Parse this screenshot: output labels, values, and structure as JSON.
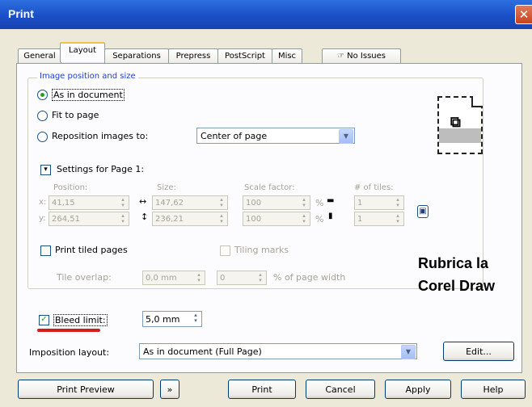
{
  "window": {
    "title": "Print",
    "close_glyph": "✕"
  },
  "tabs": [
    "General",
    "Layout",
    "Separations",
    "Prepress",
    "PostScript",
    "Misc",
    "No Issues"
  ],
  "image_position": {
    "group_label": "Image position and size",
    "options": [
      "As in document",
      "Fit to page",
      "Reposition images to:"
    ],
    "selected_index": 0,
    "reposition_value": "Center of page"
  },
  "settings": {
    "label": "Settings for Page 1:",
    "columns": {
      "position": "Position:",
      "size": "Size:",
      "scale": "Scale factor:",
      "tiles": "# of tiles:"
    },
    "x_label": "x:",
    "y_label": "y:",
    "position_x": "41,15",
    "position_y": "264,51",
    "size_w": "147,62",
    "size_h": "236,21",
    "scale_x": "100",
    "scale_y": "100",
    "percent": "%",
    "tiles_x": "1",
    "tiles_y": "1"
  },
  "tiling": {
    "print_tiled_label": "Print tiled pages",
    "tiling_marks_label": "Tiling marks",
    "overlap_label": "Tile overlap:",
    "overlap_value": "0,0 mm",
    "overlap_pct_value": "0",
    "pct_of_width_label": "% of page width"
  },
  "watermark": {
    "line1": "Rubrica la",
    "line2": "Corel Draw"
  },
  "bleed": {
    "label": "Bleed limit:",
    "checked": true,
    "value": "5,0 mm"
  },
  "imposition": {
    "label": "Imposition layout:",
    "value": "As in document (Full Page)",
    "edit_label": "Edit..."
  },
  "footer": {
    "print_preview": "Print Preview",
    "print": "Print",
    "cancel": "Cancel",
    "apply": "Apply",
    "help": "Help"
  },
  "icons": {
    "close": "close-icon",
    "no_issues": "no-issues-icon",
    "page_preview": "page-preview-icon",
    "lock": "lock-icon",
    "preview_arrow": "double-arrow-icon"
  },
  "colors": {
    "titlebar": "#1a4fc7",
    "group_label": "#1c3fd0",
    "checkmark": "#21a121",
    "underline": "#d41e1e"
  }
}
